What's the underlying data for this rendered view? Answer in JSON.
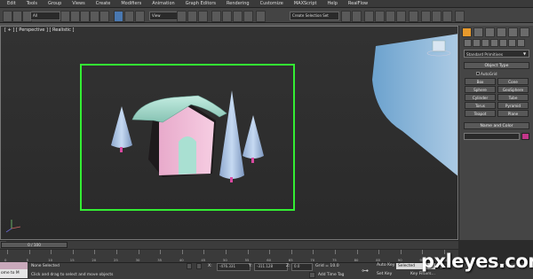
{
  "menu": [
    "Edit",
    "Tools",
    "Group",
    "Views",
    "Create",
    "Modifiers",
    "Animation",
    "Graph Editors",
    "Rendering",
    "Customize",
    "MAXScript",
    "Help",
    "RealFlow"
  ],
  "toolbar": {
    "selection_filter": "All",
    "view_dropdown": "View",
    "named_selection_placeholder": "Create Selection Set"
  },
  "viewport": {
    "label": "[ + ] [ Perspective ] [ Realistic ]",
    "selection_box_color": "#33ee33"
  },
  "command_panel": {
    "category_dropdown": "Standard Primitives",
    "object_type_title": "Object Type",
    "autogrid_label": "AutoGrid",
    "primitives": [
      "Box",
      "Cone",
      "Sphere",
      "GeoSphere",
      "Cylinder",
      "Tube",
      "Torus",
      "Pyramid",
      "Teapot",
      "Plane"
    ],
    "name_color_title": "Name and Color",
    "object_color": "#c2368a"
  },
  "timeline": {
    "frame_display": "0 / 100",
    "ticks": [
      "0",
      "5",
      "10",
      "15",
      "20",
      "25",
      "30",
      "35",
      "40",
      "45",
      "50",
      "55",
      "60",
      "65",
      "70",
      "75",
      "80",
      "85",
      "90",
      "95",
      "100"
    ]
  },
  "status": {
    "welcome_text": "ome to M",
    "selection_info": "None Selected",
    "prompt": "Click and drag to select and move objects",
    "x_label": "X:",
    "x_value": "-476.331",
    "y_label": "Y:",
    "y_value": "-311.128",
    "z_label": "Z:",
    "z_value": "0.0",
    "grid": "Grid = 10.0",
    "add_time_tag": "Add Time Tag",
    "auto_key": "Auto Key",
    "auto_key_mode": "Selected",
    "set_key": "Set Key",
    "key_filters": "Key Filters..."
  },
  "watermark": "pxleyes.com",
  "colors": {
    "house_roof": "#9fd6c8",
    "house_wall": "#f0bcd6",
    "tree": "#a9c3e6",
    "trunk": "#d84aa0"
  }
}
